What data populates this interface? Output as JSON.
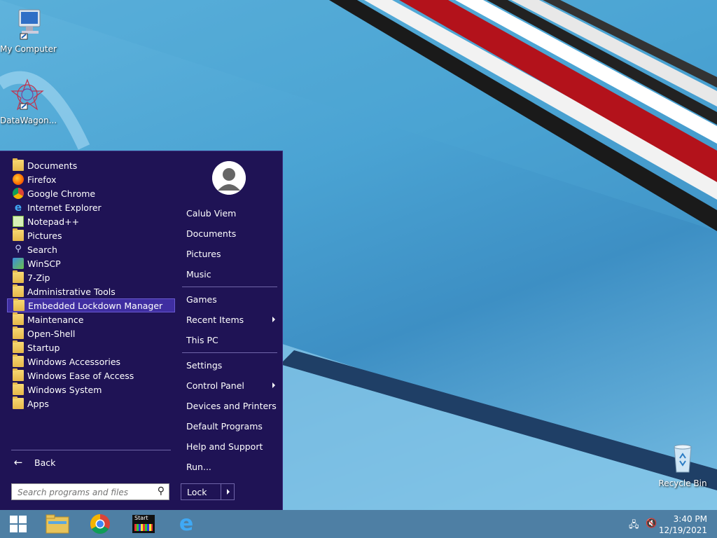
{
  "desktop": {
    "icons": [
      {
        "label": "My Computer",
        "icon": "computer-icon"
      },
      {
        "label": "DataWagon...",
        "icon": "datawagon-icon"
      },
      {
        "label": "Recycle Bin",
        "icon": "recycle-bin-icon"
      }
    ]
  },
  "start_menu": {
    "programs": [
      {
        "label": "Documents",
        "icon": "folder-icon"
      },
      {
        "label": "Firefox",
        "icon": "firefox-icon"
      },
      {
        "label": "Google Chrome",
        "icon": "chrome-icon"
      },
      {
        "label": "Internet Explorer",
        "icon": "ie-icon"
      },
      {
        "label": "Notepad++",
        "icon": "notepad-plus-plus-icon"
      },
      {
        "label": "Pictures",
        "icon": "folder-icon"
      },
      {
        "label": "Search",
        "icon": "search-icon"
      },
      {
        "label": "WinSCP",
        "icon": "winscp-icon"
      },
      {
        "label": "7-Zip",
        "icon": "folder-icon"
      },
      {
        "label": "Administrative Tools",
        "icon": "folder-icon"
      },
      {
        "label": "Embedded Lockdown Manager",
        "icon": "folder-icon",
        "highlighted": true
      },
      {
        "label": "Maintenance",
        "icon": "folder-icon"
      },
      {
        "label": "Open-Shell",
        "icon": "folder-icon"
      },
      {
        "label": "Startup",
        "icon": "folder-icon"
      },
      {
        "label": "Windows Accessories",
        "icon": "folder-icon"
      },
      {
        "label": "Windows Ease of Access",
        "icon": "folder-icon"
      },
      {
        "label": "Windows System",
        "icon": "folder-icon"
      },
      {
        "label": "Apps",
        "icon": "folder-icon"
      }
    ],
    "back_label": "Back",
    "search_placeholder": "Search programs and files",
    "user_name": "Calub Viem",
    "right_items": [
      {
        "label": "Documents"
      },
      {
        "label": "Pictures"
      },
      {
        "label": "Music"
      },
      {
        "label": "Games"
      },
      {
        "label": "Recent Items",
        "submenu": true
      },
      {
        "label": "This PC"
      },
      {
        "label": "Settings"
      },
      {
        "label": "Control Panel",
        "submenu": true
      },
      {
        "label": "Devices and Printers"
      },
      {
        "label": "Default Programs"
      },
      {
        "label": "Help and Support"
      },
      {
        "label": "Run..."
      }
    ],
    "lock_label": "Lock"
  },
  "taskbar": {
    "pinned": [
      "start-button",
      "file-explorer-icon",
      "chrome-icon",
      "start-app-icon",
      "ie-icon"
    ],
    "start_app_label": "Start",
    "time": "3:40 PM",
    "date": "12/19/2021"
  },
  "colors": {
    "start_menu_bg": "#1f1355",
    "highlight": "#3f2ea1",
    "taskbar": "#4e7fa4"
  }
}
